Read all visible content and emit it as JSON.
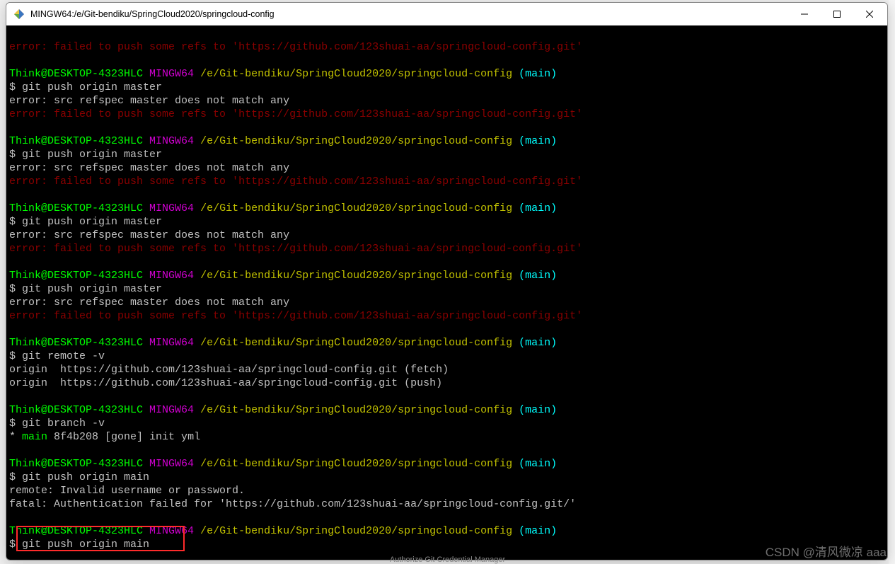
{
  "window": {
    "title": "MINGW64:/e/Git-bendiku/SpringCloud2020/springcloud-config"
  },
  "prompt": {
    "userhost": "Think@DESKTOP-4323HLC",
    "shell": "MINGW64",
    "path": "/e/Git-bendiku/SpringCloud2020/springcloud-config",
    "branch": "(main)",
    "dollar": "$ "
  },
  "cmd": {
    "push_master": "git push origin master",
    "remote_v": "git remote -v",
    "branch_v": "git branch -v",
    "push_main": "git push origin main"
  },
  "err": {
    "specmsg": "error: src refspec master does not match any",
    "failprefix": "error: failed to push some refs to '",
    "url": "https://github.com/123shuai-aa/springcloud-config.git",
    "suffix": "'"
  },
  "remote": {
    "fetch": "origin  https://github.com/123shuai-aa/springcloud-config.git (fetch)",
    "push": "origin  https://github.com/123shuai-aa/springcloud-config.git (push)"
  },
  "branch_out": {
    "star": "* ",
    "name": "main",
    "rest": " 8f4b208 [gone] init yml"
  },
  "auth": {
    "remote_line": "remote: Invalid username or password.",
    "fatal_line": "fatal: Authentication failed for 'https://github.com/123shuai-aa/springcloud-config.git/'"
  },
  "watermark": "CSDN @清风微凉 aaa",
  "bottom_hint": "Authorize Git Credential Manager"
}
